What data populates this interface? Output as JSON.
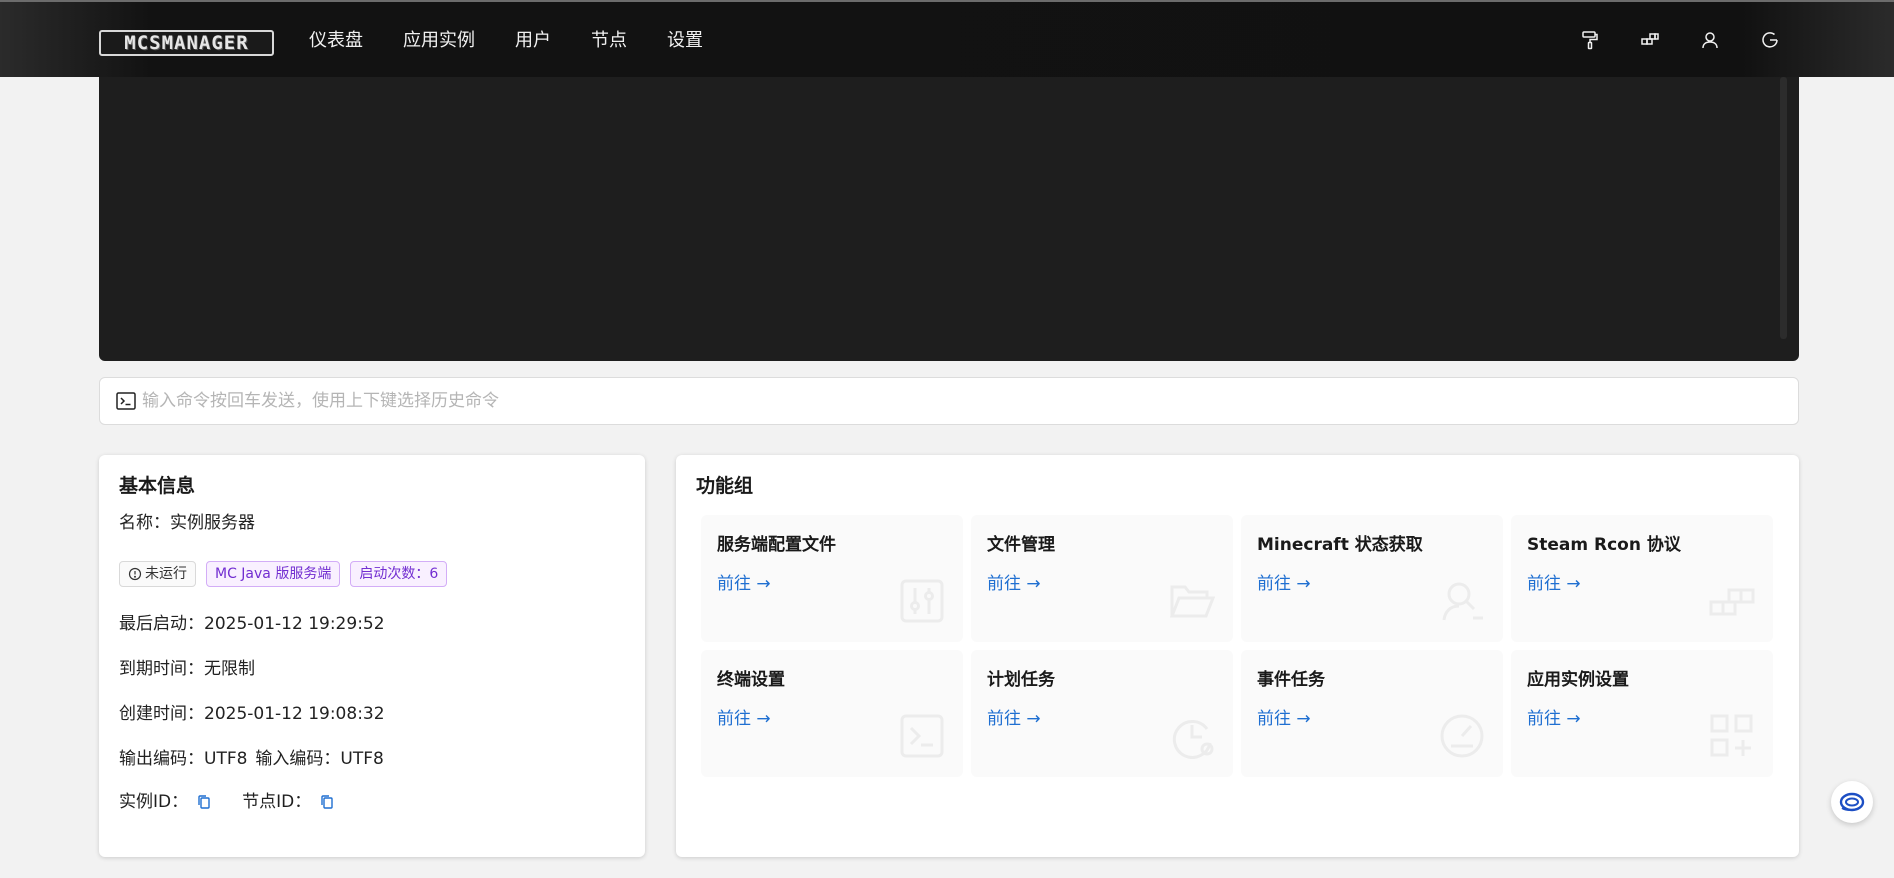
{
  "nav": {
    "logo_text": "MCSMANAGER",
    "items": [
      {
        "label": "仪表盘"
      },
      {
        "label": "应用实例"
      },
      {
        "label": "用户"
      },
      {
        "label": "节点"
      },
      {
        "label": "设置"
      }
    ],
    "right_icons": [
      "paint-roller-icon",
      "blocks-icon",
      "user-icon",
      "logout-icon"
    ]
  },
  "command": {
    "placeholder": "输入命令按回车发送，使用上下键选择历史命令"
  },
  "basic_info": {
    "title": "基本信息",
    "name_label": "名称：",
    "name_value": "实例服务器",
    "tags": [
      {
        "text": "未运行",
        "icon": "info-circle-icon"
      },
      {
        "text": "MC Java 版服务端"
      },
      {
        "text": "启动次数：6"
      }
    ],
    "last_start_label": "最后启动：",
    "last_start_value": "2025-01-12 19:29:52",
    "expire_label": "到期时间：",
    "expire_value": "无限制",
    "created_label": "创建时间：",
    "created_value": "2025-01-12 19:08:32",
    "output_encoding_label": "输出编码：",
    "output_encoding_value": "UTF8",
    "input_encoding_label": "输入编码：",
    "input_encoding_value": "UTF8",
    "instance_id_label": "实例ID：",
    "node_id_label": "节点ID："
  },
  "functions": {
    "title": "功能组",
    "link_label": "前往 →",
    "tiles": [
      {
        "title": "服务端配置文件",
        "icon": "sliders-icon"
      },
      {
        "title": "文件管理",
        "icon": "folder-open-icon"
      },
      {
        "title": "Minecraft 状态获取",
        "icon": "search-user-icon"
      },
      {
        "title": "Steam Rcon 协议",
        "icon": "blocks-icon"
      },
      {
        "title": "终端设置",
        "icon": "terminal-icon"
      },
      {
        "title": "计划任务",
        "icon": "clock-history-icon"
      },
      {
        "title": "事件任务",
        "icon": "gauge-icon"
      },
      {
        "title": "应用实例设置",
        "icon": "apps-grid-icon"
      }
    ]
  },
  "colors": {
    "accent": "#1f6fd1",
    "nav_bg": "#111111",
    "terminal_bg": "#1e1e1e",
    "tag_purple": "#722ed1"
  }
}
